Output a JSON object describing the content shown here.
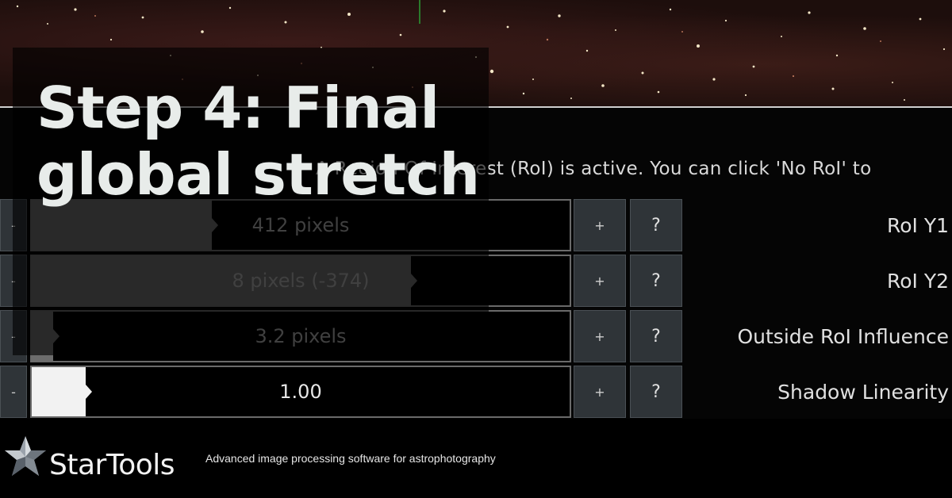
{
  "overlay": {
    "title": "Step 4: Final global stretch"
  },
  "panel": {
    "info_text": "A Region Of Interest (RoI) is active. You can click 'No RoI' to",
    "rows": [
      {
        "minus": "-",
        "value": "412 pixels",
        "fill_fraction": 0.335,
        "plus": "+",
        "help": "?",
        "label": "RoI Y1"
      },
      {
        "minus": "-",
        "value": "8 pixels (-374)",
        "fill_fraction": 0.705,
        "plus": "+",
        "help": "?",
        "label": "RoI Y2"
      },
      {
        "minus": "-",
        "value": "3.2 pixels",
        "fill_fraction": 0.04,
        "plus": "+",
        "help": "?",
        "label": "Outside RoI Influence"
      },
      {
        "minus": "-",
        "value": "1.00",
        "fill_fraction": 0.1,
        "plus": "+",
        "help": "?",
        "label": "Shadow Linearity"
      }
    ]
  },
  "footer": {
    "logo_text": "StarTools",
    "tagline": "Advanced image processing software for astrophotography"
  },
  "colors": {
    "panel_bg": "#050505",
    "button_bg": "#2f3438",
    "slider_fill": "#6c6c6c",
    "slider_fill_active": "#f2f2f2",
    "title_text": "#e8ecea"
  }
}
